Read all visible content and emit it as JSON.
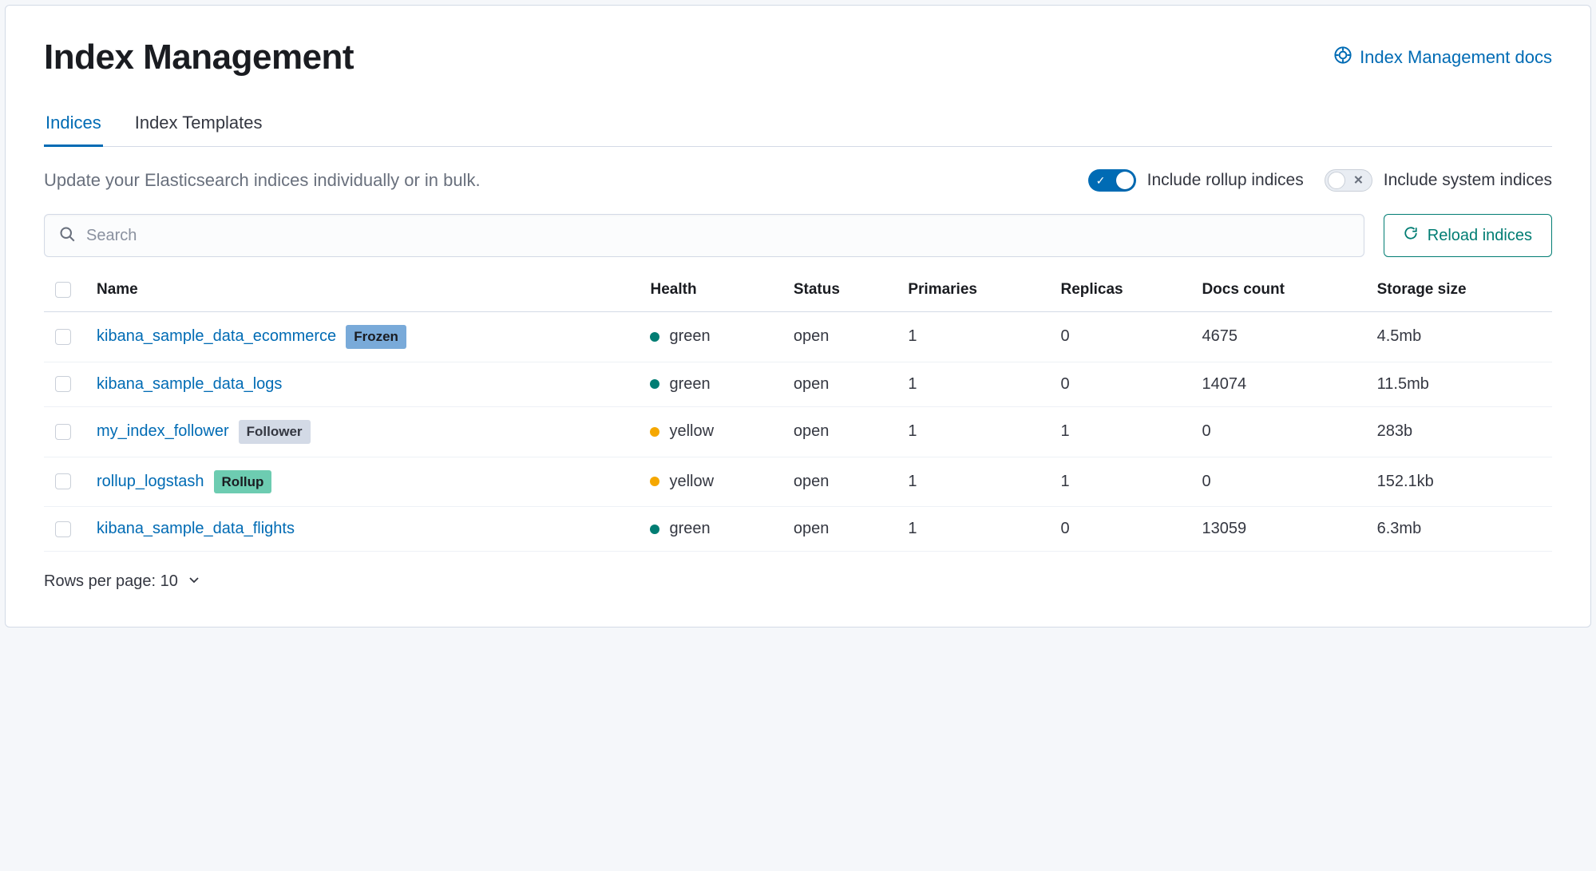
{
  "header": {
    "title": "Index Management",
    "docs_link": "Index Management docs"
  },
  "tabs": {
    "indices": "Indices",
    "templates": "Index Templates"
  },
  "toolbar": {
    "subtitle": "Update your Elasticsearch indices individually or in bulk.",
    "toggle_rollup_label": "Include rollup indices",
    "toggle_system_label": "Include system indices",
    "toggle_rollup_on": true,
    "toggle_system_on": false
  },
  "actions": {
    "search_placeholder": "Search",
    "reload_label": "Reload indices"
  },
  "table": {
    "columns": {
      "name": "Name",
      "health": "Health",
      "status": "Status",
      "primaries": "Primaries",
      "replicas": "Replicas",
      "docs": "Docs count",
      "storage": "Storage size"
    },
    "rows": [
      {
        "name": "kibana_sample_data_ecommerce",
        "badge": "Frozen",
        "badge_class": "frozen",
        "health": "green",
        "status": "open",
        "primaries": "1",
        "replicas": "0",
        "docs": "4675",
        "storage": "4.5mb"
      },
      {
        "name": "kibana_sample_data_logs",
        "badge": "",
        "badge_class": "",
        "health": "green",
        "status": "open",
        "primaries": "1",
        "replicas": "0",
        "docs": "14074",
        "storage": "11.5mb"
      },
      {
        "name": "my_index_follower",
        "badge": "Follower",
        "badge_class": "follower",
        "health": "yellow",
        "status": "open",
        "primaries": "1",
        "replicas": "1",
        "docs": "0",
        "storage": "283b"
      },
      {
        "name": "rollup_logstash",
        "badge": "Rollup",
        "badge_class": "rollup",
        "health": "yellow",
        "status": "open",
        "primaries": "1",
        "replicas": "1",
        "docs": "0",
        "storage": "152.1kb"
      },
      {
        "name": "kibana_sample_data_flights",
        "badge": "",
        "badge_class": "",
        "health": "green",
        "status": "open",
        "primaries": "1",
        "replicas": "0",
        "docs": "13059",
        "storage": "6.3mb"
      }
    ]
  },
  "footer": {
    "rows_per_page_label": "Rows per page: 10"
  }
}
